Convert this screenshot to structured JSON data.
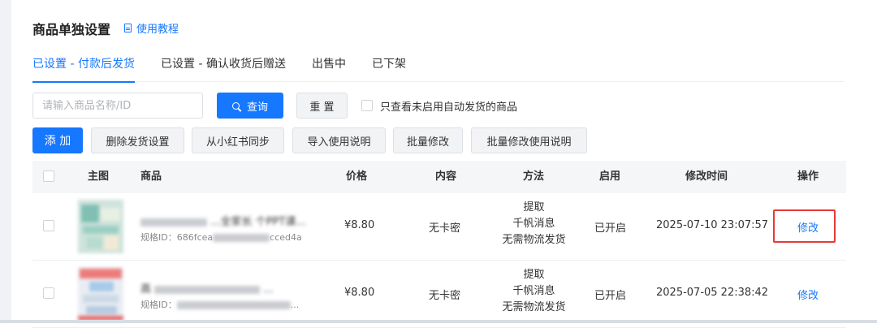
{
  "header": {
    "title": "商品单独设置",
    "help_link": "使用教程"
  },
  "tabs": [
    {
      "label": "已设置 - 付款后发货",
      "active": true
    },
    {
      "label": "已设置 - 确认收货后赠送",
      "active": false
    },
    {
      "label": "出售中",
      "active": false
    },
    {
      "label": "已下架",
      "active": false
    }
  ],
  "search": {
    "placeholder": "请输入商品名称/ID",
    "value": "",
    "query_label": "查询",
    "reset_label": "重 置"
  },
  "filter": {
    "checked": false,
    "label": "只查看未启用自动发货的商品"
  },
  "toolbar": {
    "add": "添 加",
    "delete_settings": "删除发货设置",
    "sync_xiaohongshu": "从小红书同步",
    "import_instructions": "导入使用说明",
    "batch_edit": "批量修改",
    "batch_edit_instructions": "批量修改使用说明"
  },
  "table": {
    "columns": {
      "image": "主图",
      "product": "商品",
      "price": "价格",
      "content": "内容",
      "method": "方法",
      "enabled": "启用",
      "modified": "修改时间",
      "action": "操作"
    },
    "rows": [
      {
        "title_prefix": "",
        "title_suffix": "...全家长 个PPT课...",
        "spec_prefix": "规格ID：686fcea",
        "spec_suffix": "cced4a",
        "price": "¥8.80",
        "content": "无卡密",
        "method_lines": [
          "提取",
          "千帆消息",
          "无需物流发货"
        ],
        "enabled": "已开启",
        "modified": "2025-07-10 23:07:57",
        "action": "修改",
        "highlighted": true
      },
      {
        "title_prefix": "高",
        "title_suffix": "...",
        "spec_prefix": "规格ID：",
        "spec_suffix": "...",
        "price": "¥8.80",
        "content": "无卡密",
        "method_lines": [
          "提取",
          "千帆消息",
          "无需物流发货"
        ],
        "enabled": "已开启",
        "modified": "2025-07-05 22:38:42",
        "action": "修改",
        "highlighted": false
      }
    ]
  },
  "colors": {
    "accent": "#1677ff",
    "highlight_border": "#e53935",
    "header_bg": "#f5f6f8"
  }
}
